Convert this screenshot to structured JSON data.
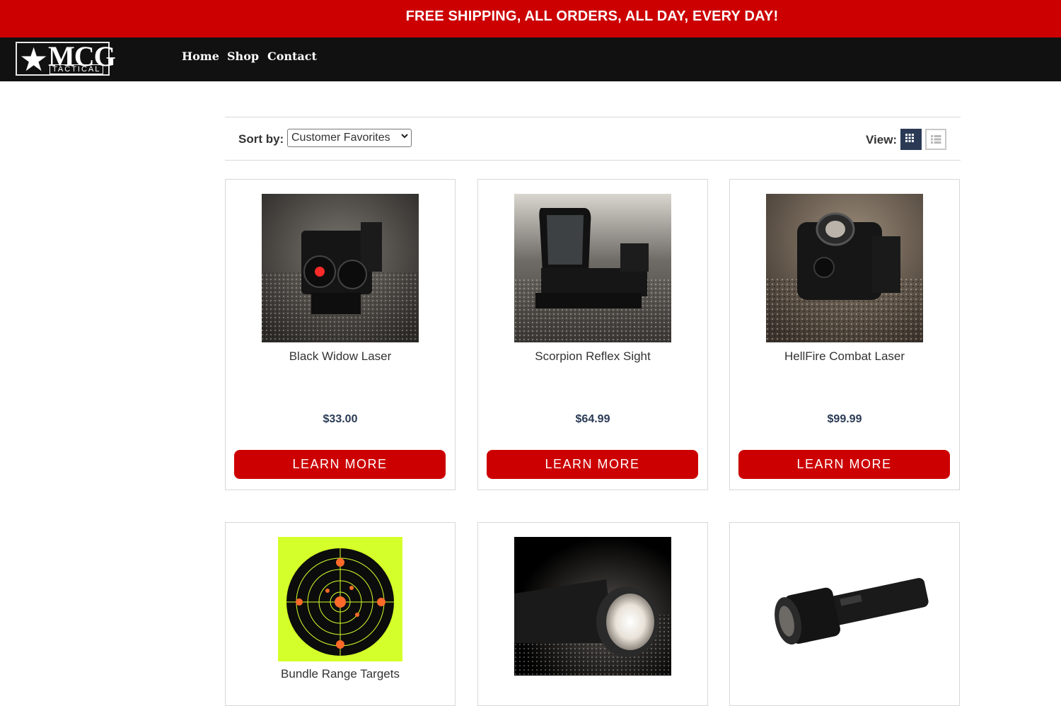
{
  "promo": {
    "text": "FREE SHIPPING, ALL ORDERS, ALL DAY, EVERY DAY!"
  },
  "logo": {
    "brand": "MCG",
    "sub": "TACTICAL",
    "star": "★"
  },
  "nav": {
    "items": [
      "Home",
      "Shop",
      "Contact"
    ]
  },
  "toolbar": {
    "sort_label": "Sort by:",
    "sort_value": "Customer Favorites",
    "view_label": "View:",
    "view_grid_icon": "grid-icon",
    "view_list_icon": "list-icon"
  },
  "products": [
    {
      "name": "Black Widow Laser",
      "price": "$33.00",
      "button": "LEARN MORE"
    },
    {
      "name": "Scorpion Reflex Sight",
      "price": "$64.99",
      "button": "LEARN MORE"
    },
    {
      "name": "HellFire Combat Laser",
      "price": "$99.99",
      "button": "LEARN MORE"
    },
    {
      "name": "Bundle Range Targets"
    },
    {
      "name": ""
    },
    {
      "name": ""
    }
  ],
  "colors": {
    "accent": "#cc0000",
    "nav_bg": "#111111",
    "price": "#2a3a55"
  }
}
